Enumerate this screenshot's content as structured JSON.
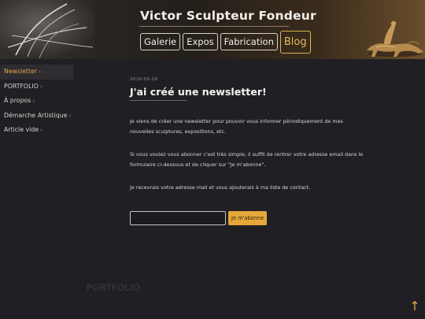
{
  "header": {
    "site_title": "Victor Sculpteur Fondeur",
    "nav": [
      {
        "label": "Galerie",
        "active": false
      },
      {
        "label": "Expos",
        "active": false
      },
      {
        "label": "Fabrication",
        "active": false
      },
      {
        "label": "Blog",
        "active": true
      }
    ]
  },
  "sidebar": {
    "items": [
      {
        "label": "Newsletter",
        "active": true
      },
      {
        "label": "PORTFOLIO",
        "active": false
      },
      {
        "label": "À propos",
        "active": false
      },
      {
        "label": "Démarche Artistique",
        "active": false
      },
      {
        "label": "Article vide",
        "active": false
      }
    ],
    "chevron": "›"
  },
  "post": {
    "date": "2026-05-20",
    "title": "J'ai créé une newsletter!",
    "paragraphs": [
      "Je viens de créer une newsletter pour pouvoir vous informer périodiquement de mes nouvelles sculptures, expositions, etc.",
      "Si vous voulez vous abonner c'est très simple, il suffit de rentrer votre adresse email dans le formulaire ci-dessous et de cliquer sur \"Je m'abonne\".",
      "Je recevrais votre adresse mail et vous ajouterais à ma liste de contact."
    ]
  },
  "form": {
    "email_value": "",
    "subscribe_label": "Je m'abonne"
  },
  "footer": {
    "section_kicker": "",
    "section_word": "PORTFOLIO"
  },
  "back_to_top": "↑",
  "colors": {
    "accent": "#e2a64c",
    "button": "#e6a83a",
    "background": "#201f23"
  }
}
